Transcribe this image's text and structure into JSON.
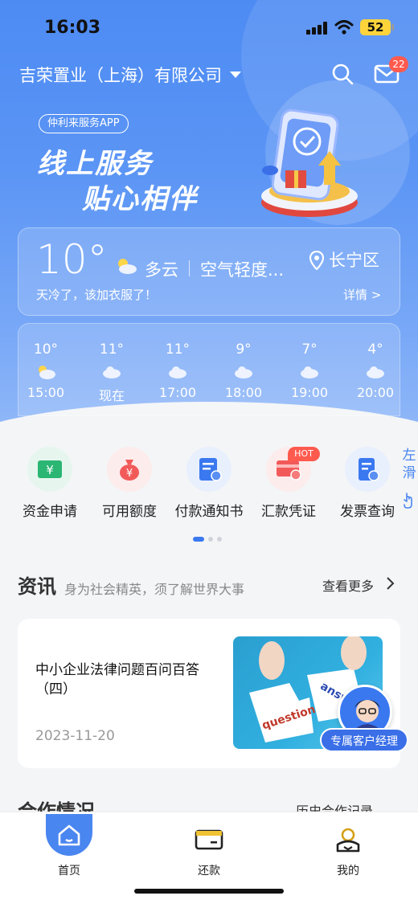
{
  "status": {
    "time": "16:03",
    "battery": "52"
  },
  "header": {
    "company": "吉荣置业（上海）有限公司",
    "mail_count": "22"
  },
  "banner": {
    "app_tag": "仲利来服务APP",
    "slogan_line1": "线上服务",
    "slogan_line2": "贴心相伴"
  },
  "weather": {
    "temp": "10°",
    "condition": "多云",
    "air": "空气轻度...",
    "location": "长宁区",
    "tip": "天冷了，该加衣服了！",
    "detail": "详情 >",
    "hourly": [
      {
        "temp": "10°",
        "time": "15:00",
        "icon": "cloud-sun-icon"
      },
      {
        "temp": "11°",
        "time": "现在",
        "icon": "cloud-icon"
      },
      {
        "temp": "11°",
        "time": "17:00",
        "icon": "cloud-icon"
      },
      {
        "temp": "9°",
        "time": "18:00",
        "icon": "cloud-icon"
      },
      {
        "temp": "7°",
        "time": "19:00",
        "icon": "cloud-icon"
      },
      {
        "temp": "4°",
        "time": "20:00",
        "icon": "cloud-icon"
      }
    ]
  },
  "quick_actions": [
    {
      "label": "资金申请",
      "icon": "fund-application-icon",
      "color": "#2bb673"
    },
    {
      "label": "可用额度",
      "icon": "money-bag-icon",
      "color": "#f25a5a"
    },
    {
      "label": "付款通知书",
      "icon": "payment-notice-icon",
      "color": "#3a78f0"
    },
    {
      "label": "汇款凭证",
      "icon": "remittance-card-icon",
      "color": "#f25a5a"
    },
    {
      "label": "发票查询",
      "icon": "invoice-icon",
      "color": "#3a78f0"
    }
  ],
  "hot_badge": "HOT",
  "swipe_hint": "左滑",
  "news": {
    "title": "资讯",
    "subtitle": "身为社会精英，须了解世界大事",
    "more": "查看更多",
    "item": {
      "headline": "中小企业法律问题百问百答（四）",
      "date": "2023-11-20",
      "img_words": [
        "question",
        "answe"
      ]
    }
  },
  "manager": {
    "label": "专属客户经理"
  },
  "coop": {
    "title": "合作情况",
    "more": "历史合作记录"
  },
  "tabs": [
    {
      "label": "首页"
    },
    {
      "label": "还款"
    },
    {
      "label": "我的"
    }
  ],
  "colors": {
    "primary": "#3a78f0",
    "hero": "#5b95f5",
    "badge": "#ff5a4e"
  }
}
